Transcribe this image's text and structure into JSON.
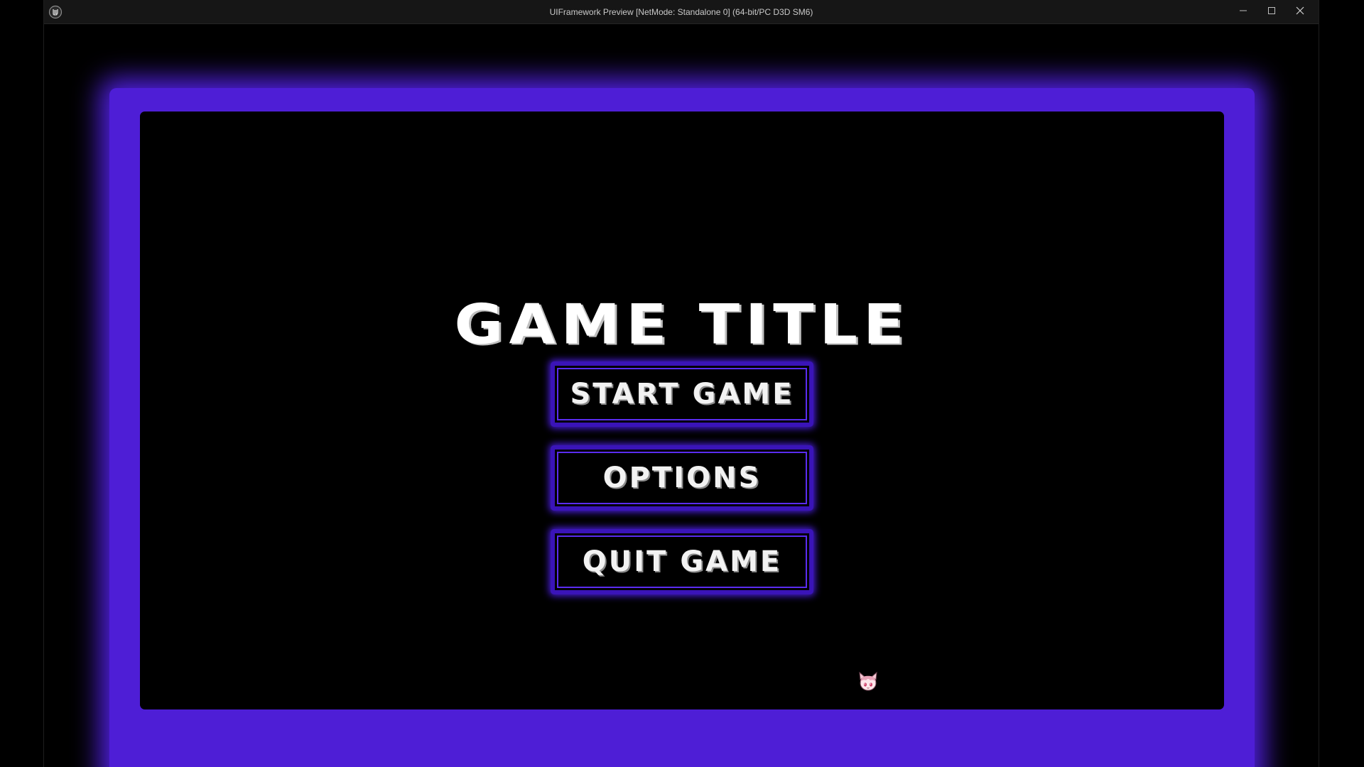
{
  "window": {
    "title": "UIFramework Preview [NetMode: Standalone 0]  (64-bit/PC D3D SM6)",
    "controls": {
      "minimize_icon": "minimize-icon",
      "maximize_icon": "maximize-icon",
      "close_icon": "close-icon"
    },
    "logo_icon": "unreal-logo-icon"
  },
  "menu": {
    "title": "GAME TITLE",
    "buttons": [
      {
        "label": "START GAME"
      },
      {
        "label": "OPTIONS"
      },
      {
        "label": "QUIT GAME"
      }
    ]
  },
  "colors": {
    "frame_glow": "#4f1fdc",
    "button_border": "#3a14b8",
    "panel_background": "#000000",
    "title_bar": "#161616"
  },
  "cursor": {
    "icon": "anime-cat-girl-cursor-icon"
  }
}
